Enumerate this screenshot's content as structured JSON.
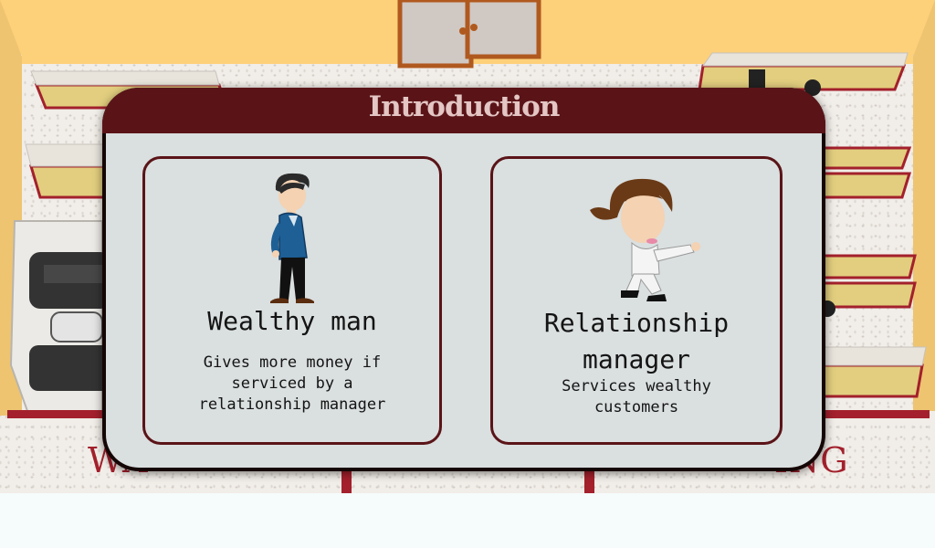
{
  "dialog": {
    "title": "Introduction",
    "title_color": "#e4c6c4",
    "frame_color": "#5a1418"
  },
  "cards": [
    {
      "name": "Wealthy man",
      "description_lines": [
        "Gives more money if",
        "serviced by a",
        "relationship manager"
      ],
      "icon": "businessman-icon"
    },
    {
      "name_lines": [
        "Relationship",
        "manager"
      ],
      "description_lines": [
        "Services wealthy",
        "customers"
      ],
      "icon": "businesswoman-icon"
    }
  ],
  "background": {
    "floor_words": [
      "WA",
      "ING"
    ],
    "accent_color": "#a3202c"
  }
}
